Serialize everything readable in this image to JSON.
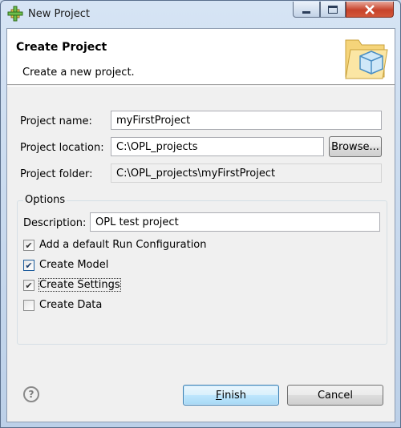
{
  "window": {
    "title": "New Project",
    "min_button": "minimize",
    "max_button": "maximize",
    "close_button": "close"
  },
  "banner": {
    "title": "Create Project",
    "subtitle": "Create a new project.",
    "icon": "project-folder-icon"
  },
  "form": {
    "name_label": "Project name:",
    "name_value": "myFirstProject",
    "location_label": "Project location:",
    "location_value": "C:\\OPL_projects",
    "browse_label": "Browse...",
    "folder_label": "Project folder:",
    "folder_value": "C:\\OPL_projects\\myFirstProject"
  },
  "options": {
    "group_label": "Options",
    "description_label": "Description:",
    "description_value": "OPL test project",
    "checkboxes": [
      {
        "label": "Add a default Run Configuration",
        "checked": true
      },
      {
        "label": "Create Model",
        "checked": true
      },
      {
        "label": "Create Settings",
        "checked": true
      },
      {
        "label": "Create Data",
        "checked": false
      }
    ]
  },
  "footer": {
    "help_glyph": "?",
    "finish_mnemonic": "F",
    "finish_rest": "inish",
    "cancel_label": "Cancel"
  },
  "colors": {
    "accent": "#3c7fb1",
    "close_red": "#c7432b"
  }
}
